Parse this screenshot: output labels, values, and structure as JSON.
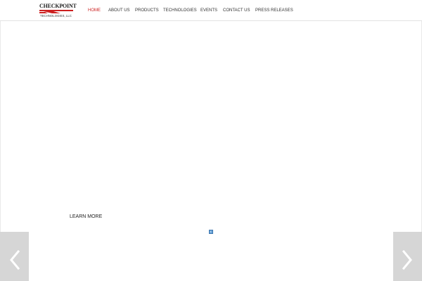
{
  "brand": {
    "name_top": "CHECKPOINT",
    "name_bottom": "TECHNOLOGIES, LLC",
    "accent_color": "#cc1f1f"
  },
  "nav": {
    "items": [
      {
        "label": "HOME",
        "active": true
      },
      {
        "label": "ABOUT US",
        "active": false
      },
      {
        "label": "PRODUCTS",
        "active": false
      },
      {
        "label": "TECHNOLOGIES",
        "active": false
      },
      {
        "label": "EVENTS",
        "active": false
      },
      {
        "label": "CONTACT US",
        "active": false
      },
      {
        "label": "PRESS RELEASES",
        "active": false
      }
    ]
  },
  "hero": {
    "cta_label": "LEARN MORE",
    "pager_icon": "slide-indicator-icon"
  },
  "slider": {
    "prev_icon": "chevron-left-icon",
    "next_icon": "chevron-right-icon",
    "arrow_bg": "#d6d6d6"
  }
}
